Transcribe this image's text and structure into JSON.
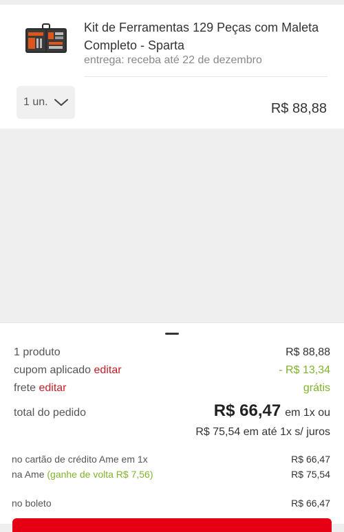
{
  "product": {
    "title": "Kit de Ferramentas 129 Peças com Maleta Completo - Sparta",
    "delivery": "entrega: receba até 22 de dezembro",
    "quantity": "1 un.",
    "price": "R$ 88,88"
  },
  "summary": {
    "products_label": "1 produto",
    "products_value": "R$ 88,88",
    "coupon_label": "cupom aplicado",
    "coupon_edit": "editar",
    "coupon_value": "- R$ 13,34",
    "shipping_label": "frete",
    "shipping_edit": "editar",
    "shipping_value": "grátis",
    "total_label": "total do pedido",
    "total_value": "R$ 66,47",
    "total_suffix": "em 1x ou",
    "installments": "R$ 75,54 em até 1x s/ juros",
    "ame_card_label": "no cartão de crédito Ame em 1x",
    "ame_card_value": "R$ 66,47",
    "ame_label": "na Ame",
    "ame_cashback": "(ganhe de volta R$ 7,56)",
    "ame_value": "R$ 75,54",
    "boleto_label": "no boleto",
    "boleto_value": "R$ 66,47"
  },
  "colors": {
    "accent_red": "#c81d25",
    "cta_red": "#e60014",
    "discount_green": "#7fb32b"
  }
}
